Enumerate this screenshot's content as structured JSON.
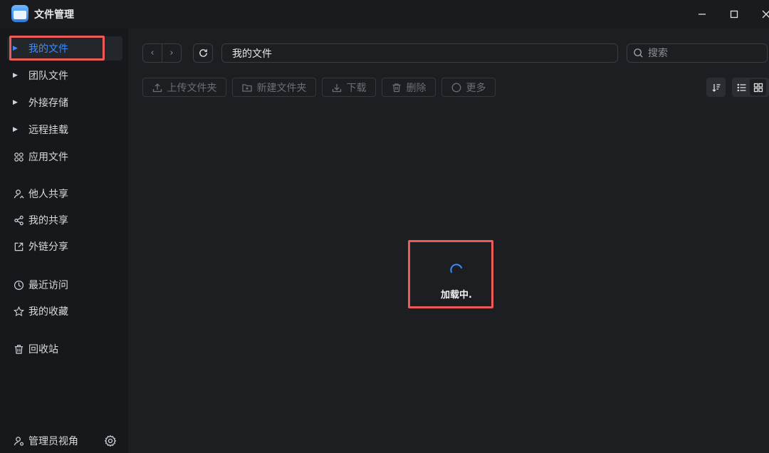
{
  "app": {
    "title": "文件管理"
  },
  "window": {
    "minimize": "—",
    "maximize": "☐",
    "close": "✕"
  },
  "sidebar": {
    "items": [
      {
        "label": "我的文件",
        "icon": "caret-right-icon",
        "active": true
      },
      {
        "label": "团队文件",
        "icon": "caret-right-icon"
      },
      {
        "label": "外接存储",
        "icon": "caret-right-icon"
      },
      {
        "label": "远程挂载",
        "icon": "caret-right-icon"
      },
      {
        "label": "应用文件",
        "icon": "apps-grid-icon"
      },
      {
        "label": "他人共享",
        "icon": "user-share-icon"
      },
      {
        "label": "我的共享",
        "icon": "share-icon"
      },
      {
        "label": "外链分享",
        "icon": "external-link-icon"
      },
      {
        "label": "最近访问",
        "icon": "clock-icon"
      },
      {
        "label": "我的收藏",
        "icon": "star-icon"
      },
      {
        "label": "回收站",
        "icon": "trash-icon"
      }
    ],
    "footer": {
      "label": "管理员视角",
      "icon": "admin-user-icon"
    }
  },
  "toolbar": {
    "path": "我的文件",
    "search_placeholder": "搜索",
    "upload_folder": "上传文件夹",
    "new_folder": "新建文件夹",
    "download": "下载",
    "delete": "删除",
    "more": "更多"
  },
  "content": {
    "loading_text": "加载中."
  },
  "colors": {
    "accent": "#3b8cff",
    "highlight": "#ee5a57",
    "background": "#1c1e22"
  }
}
